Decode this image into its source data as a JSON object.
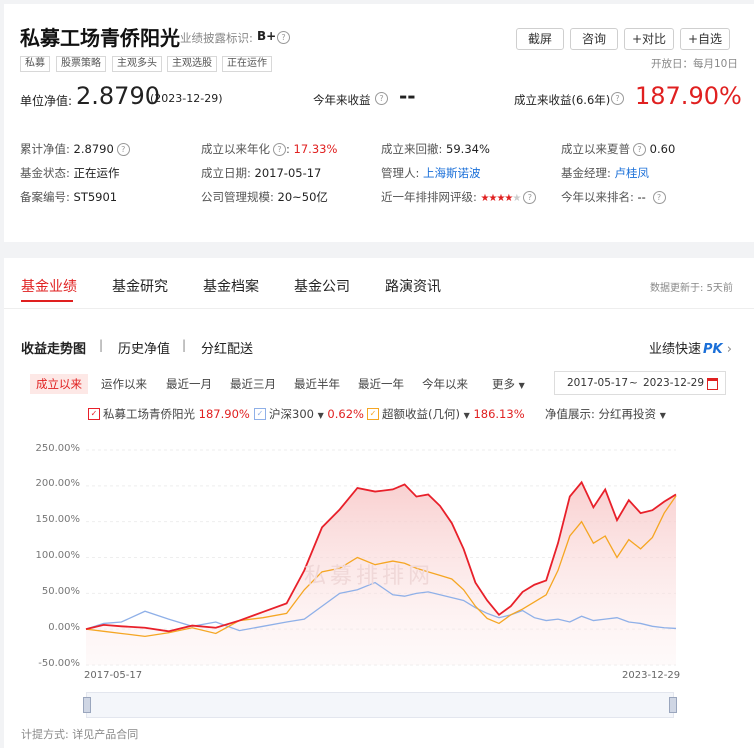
{
  "header": {
    "fund_name": "私募工场青侨阳光",
    "disclosure_label": "业绩披露标识:",
    "disclosure_value": "B+",
    "tags": [
      "私募",
      "股票策略",
      "主观多头",
      "主观选股",
      "正在运作"
    ],
    "buttons": [
      "截屏",
      "咨询",
      "+对比",
      "+自选"
    ],
    "open_day": "开放日：每月10日"
  },
  "metrics": {
    "nav_label": "单位净值:",
    "nav_value": "2.8790",
    "nav_date": "(2023-12-29)",
    "ytd_label": "今年来收益",
    "ytd_value": "--",
    "since_label": "成立来收益(6.6年)",
    "since_value": "187.90%"
  },
  "info": [
    [
      {
        "label": "累计净值:",
        "value": "2.8790"
      },
      {
        "label": "成立以来年化",
        "value": "17.33%"
      },
      {
        "label": "成立来回撤:",
        "value": "59.34%"
      },
      {
        "label": "成立以来夏普",
        "value": "0.60"
      }
    ],
    [
      {
        "label": "基金状态:",
        "value": "正在运作"
      },
      {
        "label": "成立日期:",
        "value": "2017-05-17"
      },
      {
        "label": "管理人:",
        "value": "上海斯诺波"
      },
      {
        "label": "基金经理:",
        "value": "卢桂凤"
      }
    ],
    [
      {
        "label": "备案编号:",
        "value": "ST5901"
      },
      {
        "label": "公司管理规模:",
        "value": "20~50亿"
      },
      {
        "label": "近一年排排网评级:",
        "value": ""
      },
      {
        "label": "今年以来排名:",
        "value": "--"
      }
    ]
  ],
  "rating_stars": 4,
  "nav": {
    "tabs": [
      "基金业绩",
      "基金研究",
      "基金档案",
      "基金公司",
      "路演资讯"
    ],
    "update_note": "数据更新于: 5天前"
  },
  "subtabs": [
    "收益走势图",
    "历史净值",
    "分红配送"
  ],
  "quick_link": "业绩快速",
  "quick_pk": "PK",
  "periods": [
    "成立以来",
    "运作以来",
    "最近一月",
    "最近三月",
    "最近半年",
    "最近一年",
    "今年以来",
    "更多"
  ],
  "date_range": {
    "start": "2017-05-17",
    "sep": "~",
    "end": "2023-12-29"
  },
  "legend": {
    "fund": {
      "name": "私募工场青侨阳光",
      "value": "187.90%",
      "color": "#e8202a"
    },
    "index": {
      "name": "沪深300",
      "value": "0.62%",
      "color": "#8fb0e8"
    },
    "excess": {
      "name": "超额收益(几何)",
      "value": "186.13%",
      "color": "#f5a623"
    },
    "nav_display_label": "净值展示:",
    "nav_display_value": "分红再投资"
  },
  "watermark": "私募排排网",
  "footer_note": "计提方式: 详见产品合同",
  "chart_data": {
    "type": "line",
    "x_start": "2017-05-17",
    "x_end": "2023-12-29",
    "ylim": [
      -50,
      250
    ],
    "yticks": [
      "250.00%",
      "200.00%",
      "150.00%",
      "100.00%",
      "50.00%",
      "0.00%",
      "-50.00%"
    ],
    "xtick_labels": [
      "2017-05-17",
      "2023-12-29"
    ],
    "series": [
      {
        "name": "私募工场青侨阳光",
        "color": "#e8202a",
        "x": [
          0,
          0.03,
          0.06,
          0.1,
          0.14,
          0.18,
          0.22,
          0.26,
          0.3,
          0.34,
          0.37,
          0.4,
          0.43,
          0.46,
          0.49,
          0.52,
          0.54,
          0.56,
          0.58,
          0.6,
          0.62,
          0.64,
          0.66,
          0.68,
          0.7,
          0.72,
          0.74,
          0.76,
          0.78,
          0.8,
          0.82,
          0.84,
          0.86,
          0.88,
          0.9,
          0.92,
          0.94,
          0.96,
          0.98,
          1.0
        ],
        "y": [
          0,
          6,
          4,
          2,
          -3,
          5,
          2,
          12,
          24,
          36,
          82,
          142,
          167,
          197,
          192,
          195,
          202,
          185,
          188,
          172,
          148,
          112,
          65,
          40,
          20,
          32,
          52,
          62,
          68,
          120,
          185,
          205,
          170,
          195,
          152,
          180,
          162,
          166,
          178,
          188
        ]
      },
      {
        "name": "沪深300",
        "color": "#8fb0e8",
        "x": [
          0,
          0.03,
          0.06,
          0.1,
          0.14,
          0.18,
          0.22,
          0.26,
          0.3,
          0.34,
          0.37,
          0.4,
          0.43,
          0.46,
          0.49,
          0.52,
          0.54,
          0.56,
          0.58,
          0.6,
          0.62,
          0.64,
          0.66,
          0.68,
          0.7,
          0.72,
          0.74,
          0.76,
          0.78,
          0.8,
          0.82,
          0.84,
          0.86,
          0.88,
          0.9,
          0.92,
          0.94,
          0.96,
          0.98,
          1.0
        ],
        "y": [
          0,
          8,
          10,
          25,
          14,
          4,
          10,
          -2,
          4,
          10,
          14,
          32,
          50,
          55,
          65,
          48,
          46,
          50,
          52,
          48,
          44,
          40,
          30,
          22,
          16,
          20,
          26,
          16,
          12,
          14,
          10,
          18,
          12,
          14,
          16,
          10,
          8,
          4,
          2,
          1
        ]
      },
      {
        "name": "超额收益(几何)",
        "color": "#f5a623",
        "x": [
          0,
          0.03,
          0.06,
          0.1,
          0.14,
          0.18,
          0.22,
          0.26,
          0.3,
          0.34,
          0.37,
          0.4,
          0.43,
          0.46,
          0.49,
          0.52,
          0.54,
          0.56,
          0.58,
          0.6,
          0.62,
          0.64,
          0.66,
          0.68,
          0.7,
          0.72,
          0.74,
          0.76,
          0.78,
          0.8,
          0.82,
          0.84,
          0.86,
          0.88,
          0.9,
          0.92,
          0.94,
          0.96,
          0.98,
          1.0
        ],
        "y": [
          0,
          -3,
          -6,
          -10,
          -5,
          2,
          -6,
          12,
          16,
          22,
          55,
          80,
          85,
          100,
          90,
          95,
          92,
          85,
          80,
          75,
          70,
          55,
          32,
          15,
          8,
          20,
          28,
          38,
          48,
          82,
          130,
          150,
          120,
          130,
          100,
          125,
          112,
          128,
          162,
          186
        ]
      }
    ]
  }
}
